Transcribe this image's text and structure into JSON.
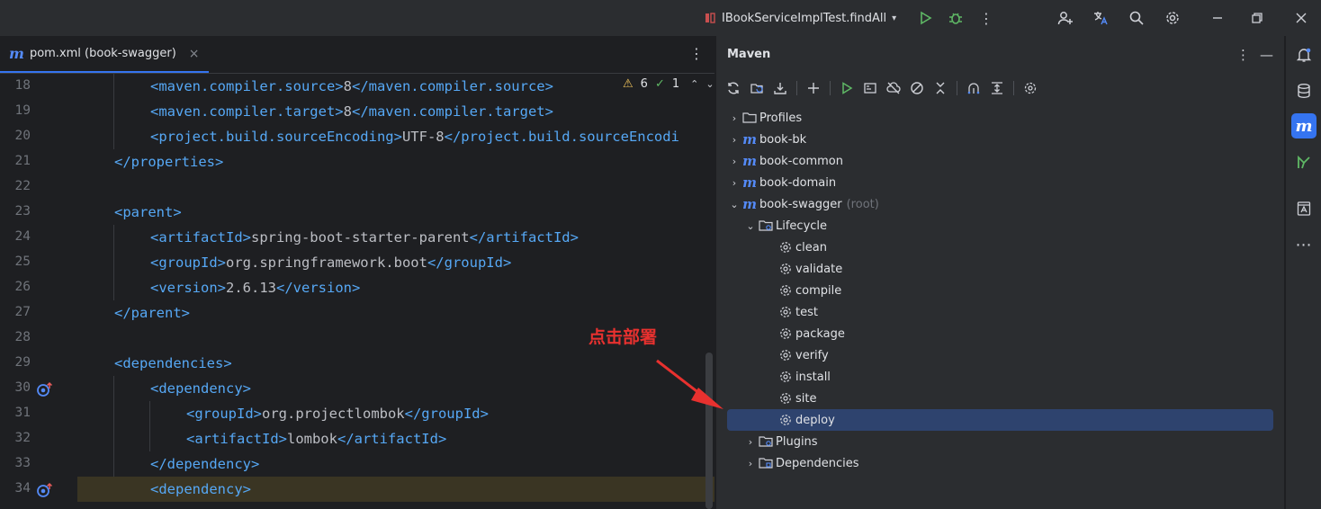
{
  "titlebar": {
    "run_config": "IBookServiceImplTest.findAll",
    "icons": [
      "run-config-icon",
      "chevron-down-icon",
      "run-icon",
      "debug-icon",
      "more-icon",
      "add-user-icon",
      "translate-icon",
      "search-icon",
      "settings-icon",
      "minimize-icon",
      "restore-icon",
      "close-icon"
    ]
  },
  "editor": {
    "tab": {
      "glyph": "m",
      "label": "pom.xml (book-swagger)",
      "close": "×"
    },
    "inspections": {
      "warnings": "6",
      "checks": "1"
    },
    "lines": [
      {
        "no": "18",
        "text": "<maven.compiler.source>8</maven.compiler.source>"
      },
      {
        "no": "19",
        "text": "<maven.compiler.target>8</maven.compiler.target>"
      },
      {
        "no": "20",
        "text": "<project.build.sourceEncoding>UTF-8</project.build.sourceEncodi"
      },
      {
        "no": "21",
        "text": "</properties>"
      },
      {
        "no": "22",
        "text": ""
      },
      {
        "no": "23",
        "text": "<parent>"
      },
      {
        "no": "24",
        "text": "<artifactId>spring-boot-starter-parent</artifactId>"
      },
      {
        "no": "25",
        "text": "<groupId>org.springframework.boot</groupId>"
      },
      {
        "no": "26",
        "text": "<version>2.6.13</version>"
      },
      {
        "no": "27",
        "text": "</parent>"
      },
      {
        "no": "28",
        "text": ""
      },
      {
        "no": "29",
        "text": "<dependencies>"
      },
      {
        "no": "30",
        "text": "<dependency>"
      },
      {
        "no": "31",
        "text": "<groupId>org.projectlombok</groupId>"
      },
      {
        "no": "32",
        "text": "<artifactId>lombok</artifactId>"
      },
      {
        "no": "33",
        "text": "</dependency>"
      },
      {
        "no": "34",
        "text": "<dependency>"
      }
    ]
  },
  "maven": {
    "title": "Maven",
    "toolbar_icons": [
      "reload-icon",
      "reimport-icon",
      "download-icon",
      "add-icon",
      "run-icon",
      "execute-goal-icon",
      "offline-icon",
      "skip-tests-icon",
      "collapse-icon",
      "show-deps-icon",
      "expand-icon",
      "settings-icon"
    ],
    "tree": [
      {
        "label": "Profiles",
        "kind": "folder",
        "depth": 0,
        "expanded": false
      },
      {
        "label": "book-bk",
        "kind": "module",
        "depth": 0,
        "expanded": false
      },
      {
        "label": "book-common",
        "kind": "module",
        "depth": 0,
        "expanded": false
      },
      {
        "label": "book-domain",
        "kind": "module",
        "depth": 0,
        "expanded": false
      },
      {
        "label": "book-swagger",
        "suffix": "(root)",
        "kind": "module",
        "depth": 0,
        "expanded": true
      },
      {
        "label": "Lifecycle",
        "kind": "lifecycle",
        "depth": 1,
        "expanded": true
      },
      {
        "label": "clean",
        "kind": "goal",
        "depth": 2
      },
      {
        "label": "validate",
        "kind": "goal",
        "depth": 2
      },
      {
        "label": "compile",
        "kind": "goal",
        "depth": 2
      },
      {
        "label": "test",
        "kind": "goal",
        "depth": 2
      },
      {
        "label": "package",
        "kind": "goal",
        "depth": 2
      },
      {
        "label": "verify",
        "kind": "goal",
        "depth": 2
      },
      {
        "label": "install",
        "kind": "goal",
        "depth": 2
      },
      {
        "label": "site",
        "kind": "goal",
        "depth": 2
      },
      {
        "label": "deploy",
        "kind": "goal",
        "depth": 2,
        "selected": true
      },
      {
        "label": "Plugins",
        "kind": "lifecycle",
        "depth": 1,
        "expanded": false
      },
      {
        "label": "Dependencies",
        "kind": "lifecycle",
        "depth": 1,
        "expanded": false
      }
    ]
  },
  "annotation": {
    "text": "点击部署"
  },
  "colors": {
    "accent": "#3574f0",
    "tag": "#56a8f5",
    "annotation": "#e8312f",
    "selection": "#2e436e"
  }
}
